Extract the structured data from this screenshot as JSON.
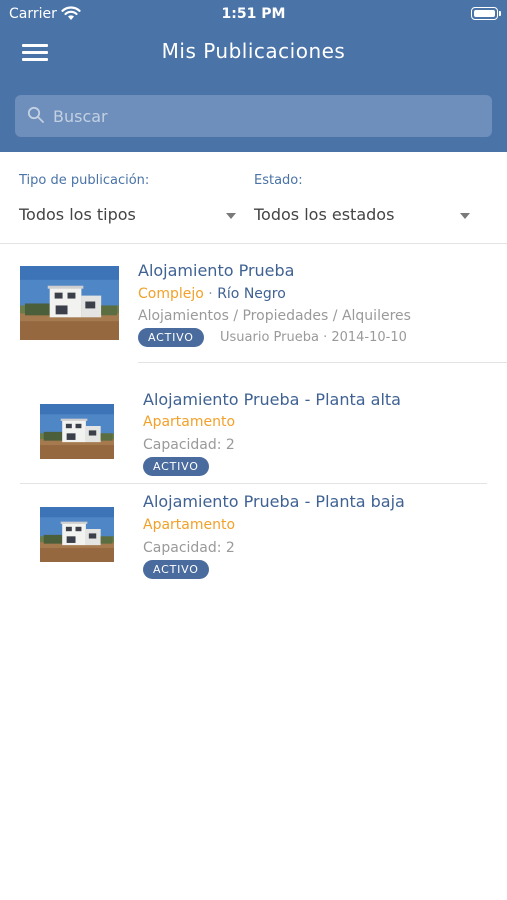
{
  "status_bar": {
    "carrier": "Carrier",
    "time": "1:51 PM"
  },
  "header": {
    "title": "Mis Publicaciones"
  },
  "search": {
    "placeholder": "Buscar"
  },
  "filters": {
    "type_label": "Tipo de publicación:",
    "type_value": "Todos los tipos",
    "state_label": "Estado:",
    "state_value": "Todos los estados"
  },
  "publications": [
    {
      "title": "Alojamiento Prueba",
      "kind": "Complejo",
      "separator": " · ",
      "location": "Río Negro",
      "category": "Alojamientos / Propiedades / Alquileres",
      "status": "ACTIVO",
      "meta": "Usuario Prueba · 2014-10-10"
    }
  ],
  "sub_publications": [
    {
      "title": "Alojamiento Prueba - Planta alta",
      "kind": "Apartamento",
      "capacity": "Capacidad: 2",
      "status": "ACTIVO"
    },
    {
      "title": "Alojamiento Prueba - Planta baja",
      "kind": "Apartamento",
      "capacity": "Capacidad: 2",
      "status": "ACTIVO"
    }
  ],
  "colors": {
    "header": "#4a73a7",
    "accent_orange": "#f1a12a",
    "badge": "#4a6b9d"
  },
  "icons": [
    "wifi-icon",
    "battery-icon",
    "menu-icon",
    "search-icon",
    "dropdown-caret-icon",
    "house-photo"
  ]
}
